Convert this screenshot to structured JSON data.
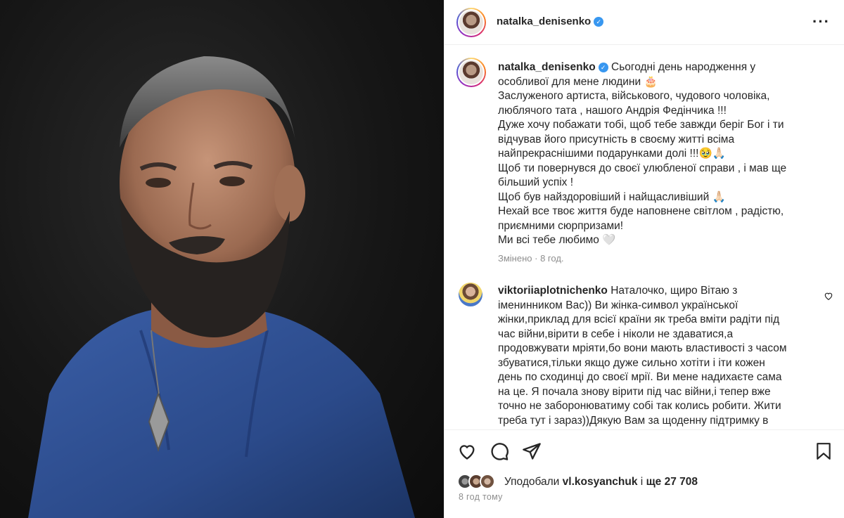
{
  "post": {
    "username": "natalka_denisenko",
    "verified_icon": "verified-badge-icon",
    "more_icon": "more-options-icon"
  },
  "caption": {
    "username": "natalka_denisenko",
    "lines": [
      "Сьогодні день народження у",
      "особливої для мене людини 🎂",
      "Заслуженого артиста, військового, чудового чоловіка,",
      "люблячого тата , нашого Андрія Федінчика !!!",
      "Дуже хочу побажати тобі, щоб тебе завжди беріг Бог і ти",
      "відчував його присутність в своєму житті всіма",
      "найпрекраснішими подарунками долі !!!🥹🙏🏻",
      "Щоб ти повернувся до своєї улюбленої справи , і мав ще",
      "більший успіх !",
      "Щоб був найздоровіший і найщасливіший 🙏🏻",
      "Нехай все твоє життя буде наповнене світлом , радістю,",
      "приємними сюрпризами!",
      "Ми всі тебе любимо 🤍"
    ],
    "edited": "Змінено",
    "separator": "·",
    "age": "8 год."
  },
  "comment": {
    "username": "viktoriiaplotnichenko",
    "lines": [
      "Наталочко, щиро Вітаю з",
      "іменинником Вас)) Ви жінка-символ української",
      "жінки,приклад для всієї країни як треба вміти радіти під",
      "час війни,вірити в себе і ніколи не здаватися,а",
      "продовжувати мріяти,бо вони мають властивості з часом",
      "збуватися,тільки якщо дуже сильно хотіти і іти кожен",
      "день по сходинці до своєї мрії. Ви мене надихаєте сама",
      "на це. Я почала знову вірити під час війни,і тепер вже",
      "точно не заборонюватиму собі так колись робити. Жити",
      "треба тут і зараз))Дякую Вам за щоденну підтримку в"
    ],
    "like_icon": "heart-outline-small-icon"
  },
  "actions": {
    "like_icon": "heart-outline-icon",
    "comment_icon": "comment-bubble-icon",
    "share_icon": "paper-plane-icon",
    "save_icon": "bookmark-icon"
  },
  "likes": {
    "prefix": "Уподобали",
    "user": "vl.kosyanchuk",
    "middle": "і",
    "count": "ще 27 708"
  },
  "timestamp": "8 год тому",
  "colors": {
    "text": "#262626",
    "secondary": "#8e8e8e",
    "verified": "#3897f0",
    "shirt": "#2f4d8c"
  }
}
